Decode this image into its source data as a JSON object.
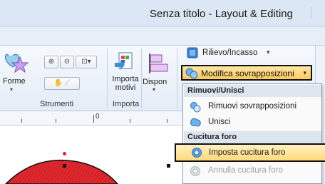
{
  "window": {
    "title": "Senza titolo - Layout & Editing"
  },
  "ribbon": {
    "forme_label": "Forme",
    "importa_motivi_label": "Importa\nmotivi",
    "disponi_label": "Dispon",
    "groups": {
      "strumenti": "Strumenti",
      "importa": "Importa"
    },
    "rilievo_label": "Rilievo/Incasso",
    "modifica_label": "Modifica sovrapposizioni"
  },
  "ruler": {
    "zero_label": "0"
  },
  "menu": {
    "section1": "Rimuovi/Unisci",
    "items1": [
      "Rimuovi sovrapposizioni",
      "Unisci"
    ],
    "section2": "Cucitura foro",
    "items2": [
      {
        "label": "Imposta cucitura foro",
        "state": "highlighted"
      },
      {
        "label": "Annulla cucitura foro",
        "state": "disabled"
      }
    ]
  },
  "colors": {
    "accent_highlight": "#ffca5c",
    "shape_fill": "#e0282e",
    "menu_border": "#8b9cb1"
  }
}
